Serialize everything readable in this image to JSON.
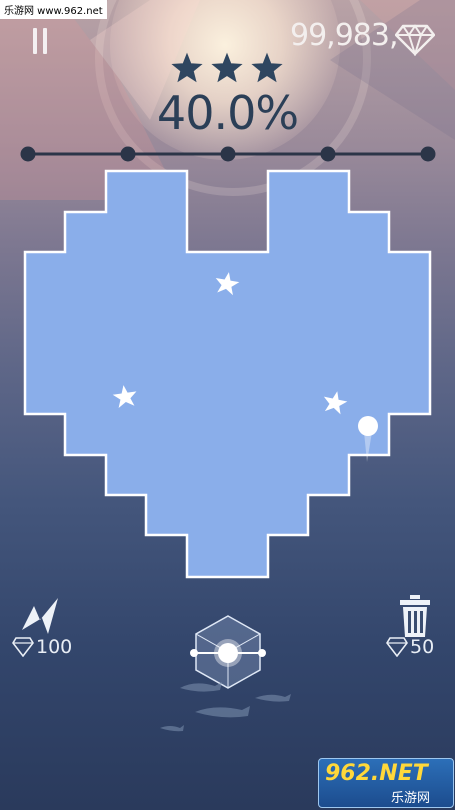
{
  "watermark_top": "乐游网 www.962.net",
  "hud": {
    "gems": "99,983,",
    "stars_earned": 3,
    "stars_total": 3,
    "percent": "40.0%",
    "progress_checkpoints": 5
  },
  "powerups": {
    "left": {
      "icon": "lightning-icon",
      "cost": "100"
    },
    "right": {
      "icon": "trash-icon",
      "cost": "50"
    }
  },
  "watermark_bottom": {
    "big": "962.NET",
    "small": "乐游网"
  },
  "colors": {
    "fill": "#8aaeea",
    "text_dark": "#2b3f57",
    "star": "#2f4660"
  }
}
